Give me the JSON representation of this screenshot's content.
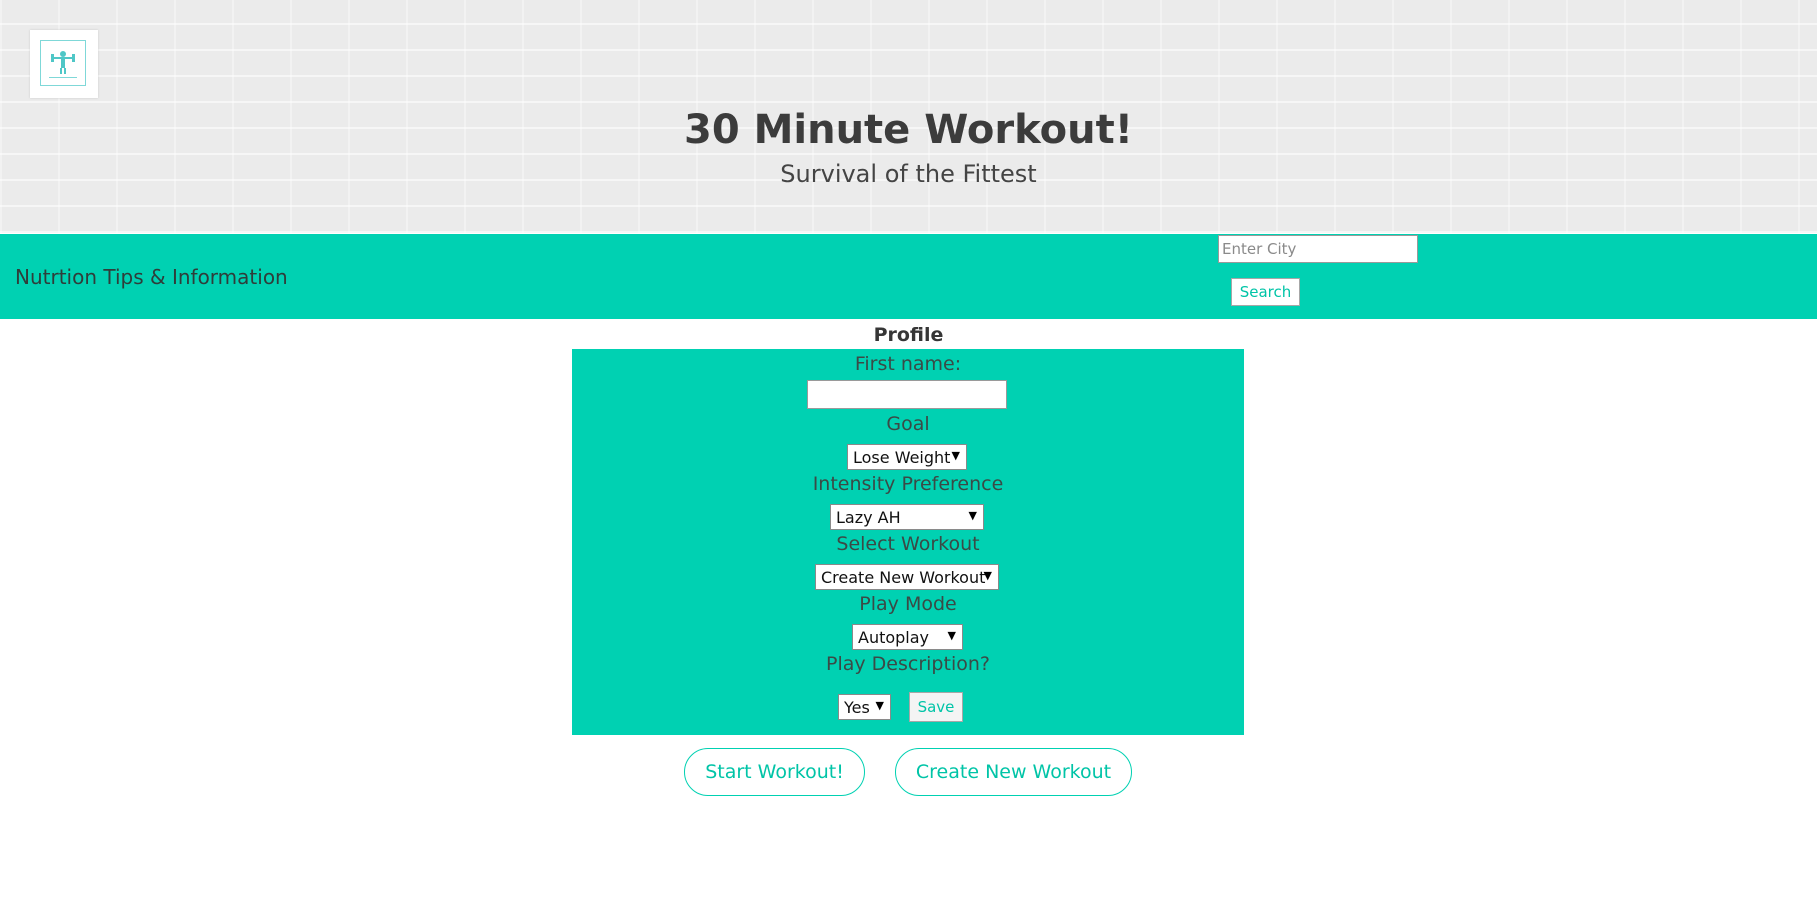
{
  "header": {
    "title": "30 Minute Workout!",
    "subtitle": "Survival of the Fittest",
    "logo_icon": "dumbbell-man-icon",
    "logo_text": "Survival of the Fittest"
  },
  "navbar": {
    "link_label": "Nutrtion Tips & Information",
    "city_placeholder": "Enter City",
    "city_value": "",
    "search_label": "Search"
  },
  "profile": {
    "heading": "Profile",
    "first_name_label": "First name:",
    "first_name_value": "",
    "goal_label": "Goal",
    "goal_selected": "Lose Weight",
    "intensity_label": "Intensity Preference",
    "intensity_selected": "Lazy AH",
    "workout_label": "Select Workout",
    "workout_selected": "Create New Workout",
    "play_mode_label": "Play Mode",
    "play_mode_selected": "Autoplay",
    "description_label": "Play Description?",
    "description_selected": "Yes",
    "save_label": "Save",
    "caret_icon": "triangle-down-icon"
  },
  "actions": {
    "start_label": "Start Workout!",
    "create_label": "Create New Workout"
  },
  "colors": {
    "accent": "#00d1b2",
    "accent_text": "#00c4a7",
    "hero_bg": "#ebebeb"
  }
}
